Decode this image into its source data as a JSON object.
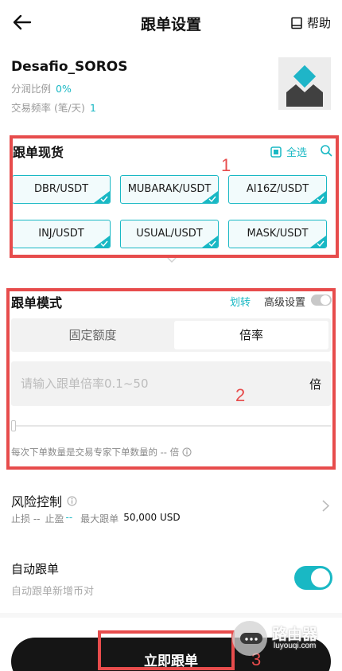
{
  "header": {
    "title": "跟单设置",
    "help_label": "帮助"
  },
  "profile": {
    "name": "Desafio_SOROS",
    "profit_share_label": "分润比例",
    "profit_share_value": "0%",
    "frequency_label": "交易频率 (笔/天)",
    "frequency_value": "1"
  },
  "spot": {
    "title": "跟单现货",
    "select_all_label": "全选",
    "pairs": [
      "DBR/USDT",
      "MUBARAK/USDT",
      "AI16Z/USDT",
      "INJ/USDT",
      "USUAL/USDT",
      "MASK/USDT"
    ]
  },
  "mode": {
    "title": "跟单模式",
    "transfer_label": "划转",
    "advanced_label": "高级设置",
    "tabs": [
      "固定额度",
      "倍率"
    ],
    "input_placeholder": "请输入跟单倍率0.1~50",
    "unit": "倍",
    "hint": "每次下单数量是交易专家下单数量的 -- 倍"
  },
  "risk": {
    "title": "风险控制",
    "stop_loss": "止损 --",
    "take_profit_label": "止盈",
    "take_profit_value": "--",
    "max_follow_label": "最大跟单",
    "max_follow_value": "50,000 USD"
  },
  "auto": {
    "title": "自动跟单",
    "subtitle": "自动跟单新增币对"
  },
  "footer": {
    "follow_button": "立即跟单"
  },
  "annotations": [
    "1",
    "2",
    "3"
  ],
  "watermark": {
    "text": "路由器",
    "sub": "luyouqi.com"
  },
  "colors": {
    "accent": "#19b8c4",
    "annotation": "#e74c4c",
    "button_bg": "#151515"
  }
}
